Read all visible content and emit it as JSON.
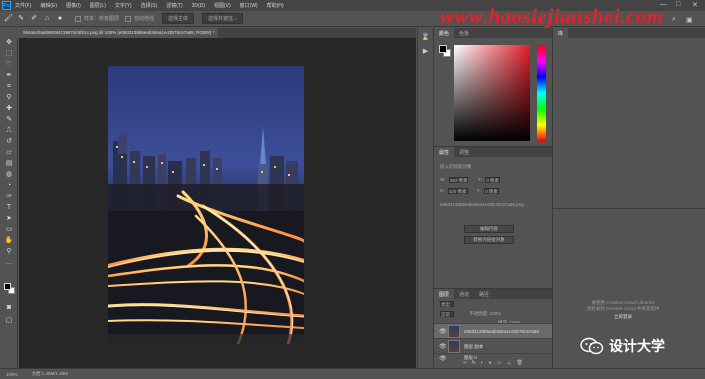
{
  "menubar": {
    "logo": "Ps",
    "items": [
      "文件(F)",
      "编辑(E)",
      "图像(I)",
      "图层(L)",
      "文字(Y)",
      "选择(S)",
      "滤镜(T)",
      "3D(D)",
      "视图(V)",
      "窗口(W)",
      "帮助(H)"
    ],
    "window_controls": [
      "—",
      "□",
      "✕"
    ]
  },
  "options": {
    "tool_icons": [
      "brush-icon",
      "pen-icon",
      "pencil-icon",
      "stamp-icon",
      "dot-icon"
    ],
    "check1": "样本：所有图层",
    "check2": "自动增强",
    "btn1": "选择主体",
    "btn2": "选择并遮住..."
  },
  "watermark": "www.haosiejianshei.com",
  "document": {
    "tab_title": "994a543aa09638421987dc6f81c.png @ 100% (e0632139b6eab3dea1e43b78c67a98, RGB/8) *"
  },
  "status": {
    "zoom": "100%",
    "doc_info": "文档:1.49M/1.49M"
  },
  "panels": {
    "color_tabs": [
      "颜色",
      "色板"
    ],
    "props_tabs": [
      "属性",
      "调整"
    ],
    "props_title": "嵌入的智能对象",
    "props_w_label": "W:",
    "props_w": "284 像素",
    "props_x_label": "X:",
    "props_x": "0 像素",
    "props_h_label": "H:",
    "props_h": "426 像素",
    "props_y_label": "Y:",
    "props_y": "0 像素",
    "props_file": "e0632139b6eab3dea1e43b78c67a98.png",
    "btn_edit": "编辑内容",
    "btn_convert": "转换为链接对象",
    "layers_tabs": [
      "图层",
      "通道",
      "路径"
    ],
    "layers_kind": "类型",
    "layers_mode": "正常",
    "layers_opacity": "不透明度: 100%",
    "layers_fill": "填充: 100%",
    "layers": [
      {
        "name": "e0632139b6eab3dea1e43b78c67a98",
        "selected": true
      },
      {
        "name": "图层 副本",
        "selected": false
      },
      {
        "name": "图层 0",
        "selected": false
      }
    ],
    "footer_icons": [
      "∞",
      "fx",
      "◐",
      "●",
      "▭",
      "＋",
      "🗑"
    ]
  },
  "right_panel": {
    "tab": "库",
    "lib_text1": "要使用 Creative Cloud Libraries",
    "lib_text2": "请登录到 Creative Cloud 并将其提供",
    "lib_link": "立即登录"
  },
  "brand": {
    "text": "设计大学"
  }
}
